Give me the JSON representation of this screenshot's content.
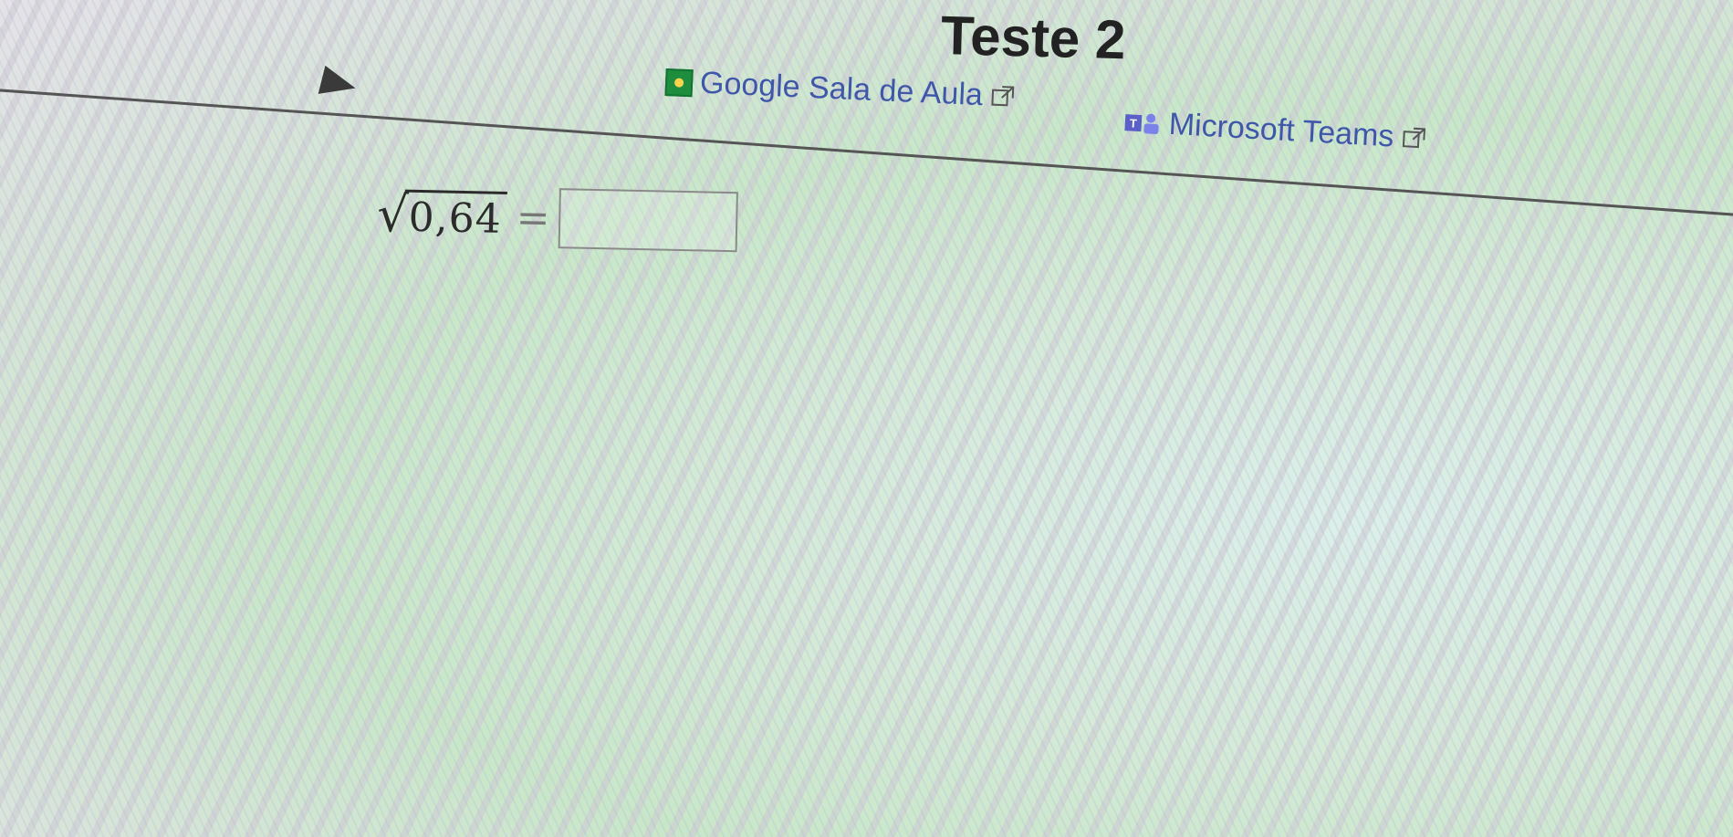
{
  "page": {
    "title": "Teste 2"
  },
  "share": {
    "classroom_label": "Google Sala de Aula",
    "teams_label": "Microsoft Teams"
  },
  "question": {
    "radicand": "0,64",
    "equals": "=",
    "answer_value": ""
  },
  "icons": {
    "collapse": "play-triangle-icon",
    "classroom": "google-classroom-icon",
    "teams": "microsoft-teams-icon",
    "external": "external-link-icon"
  },
  "colors": {
    "link": "#3f57a8",
    "classroom_green": "#1e8e3e",
    "teams_purple": "#5b5fc7"
  }
}
